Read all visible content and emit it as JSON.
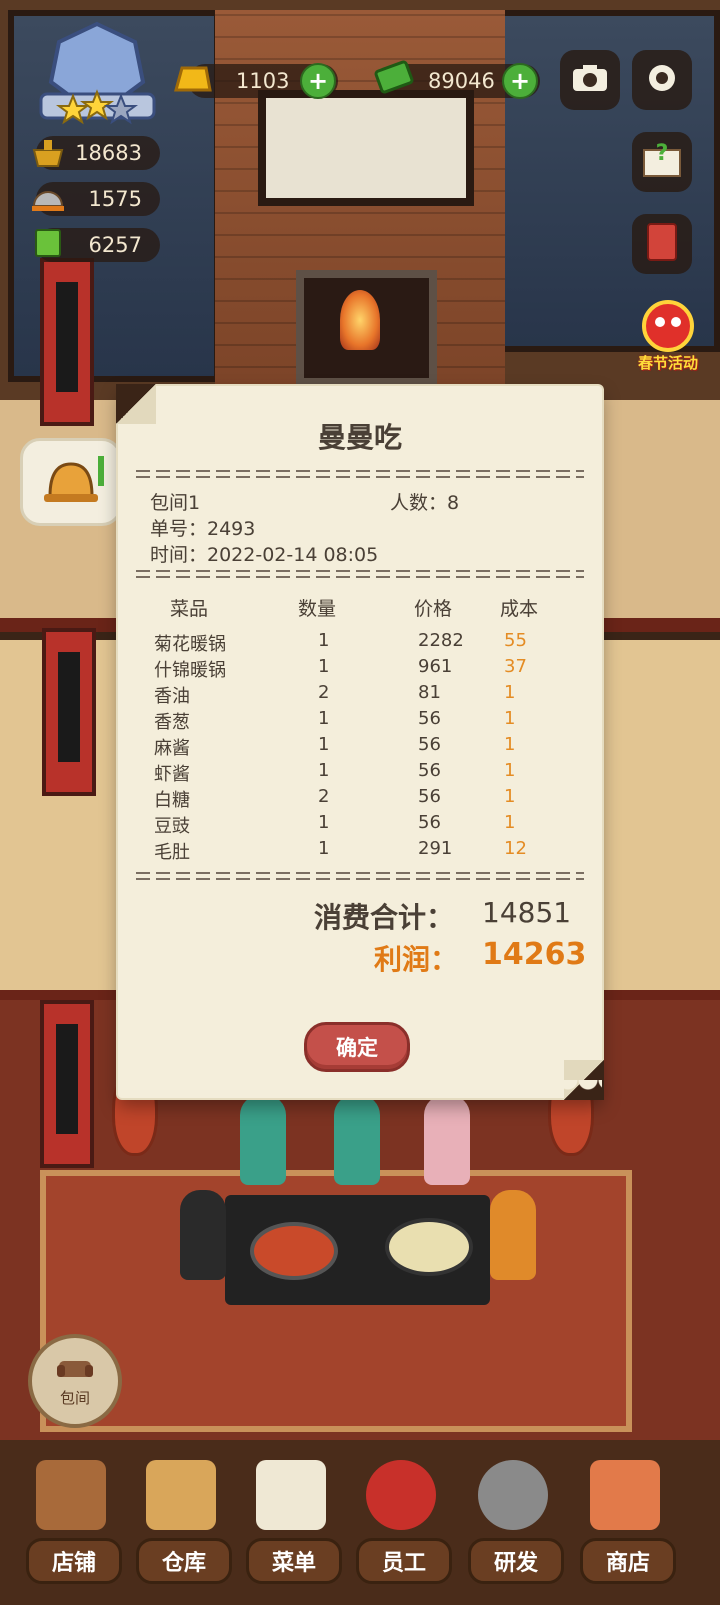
{
  "hud": {
    "gold": "1103",
    "cash": "89046",
    "stat1": "18683",
    "stat2": "1575",
    "stat3": "6257"
  },
  "event": {
    "label": "春节活动"
  },
  "receipt": {
    "title": "曼曼吃",
    "room": "包间1",
    "people": "人数：8",
    "order_no": "单号：2493",
    "time": "时间：2022-02-14 08:05",
    "headers": [
      "菜品",
      "数量",
      "价格",
      "成本"
    ],
    "items": [
      {
        "name": "菊花暖锅",
        "qty": "1",
        "price": "2282",
        "cost": "55"
      },
      {
        "name": "什锦暖锅",
        "qty": "1",
        "price": "961",
        "cost": "37"
      },
      {
        "name": "香油",
        "qty": "2",
        "price": "81",
        "cost": "1"
      },
      {
        "name": "香葱",
        "qty": "1",
        "price": "56",
        "cost": "1"
      },
      {
        "name": "麻酱",
        "qty": "1",
        "price": "56",
        "cost": "1"
      },
      {
        "name": "虾酱",
        "qty": "1",
        "price": "56",
        "cost": "1"
      },
      {
        "name": "白糖",
        "qty": "2",
        "price": "56",
        "cost": "1"
      },
      {
        "name": "豆豉",
        "qty": "1",
        "price": "56",
        "cost": "1"
      },
      {
        "name": "毛肚",
        "qty": "1",
        "price": "291",
        "cost": "12"
      }
    ],
    "total_label": "消费合计：",
    "total_value": "14851",
    "profit_label": "利润：",
    "profit_value": "14263",
    "confirm": "确定"
  },
  "room_button": "包间",
  "nav": [
    "店铺",
    "仓库",
    "菜单",
    "员工",
    "研发",
    "商店"
  ]
}
